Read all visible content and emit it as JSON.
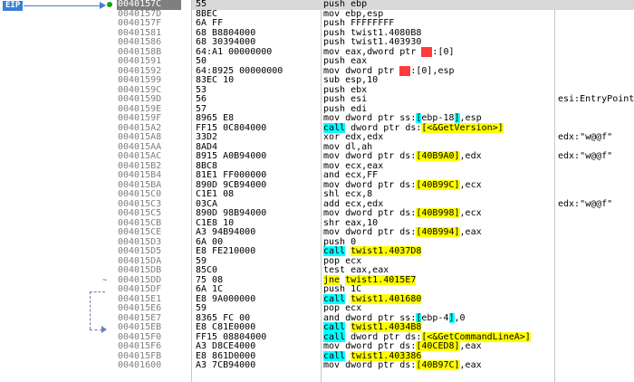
{
  "eip_label": "EIP",
  "rows": [
    {
      "addr": "0040157C",
      "bytes": "55",
      "instr": [
        {
          "t": "push ebp"
        }
      ],
      "comment": "",
      "current": true,
      "bp": true
    },
    {
      "addr": "0040157D",
      "bytes": "8BEC",
      "instr": [
        {
          "t": "mov ebp,esp"
        }
      ],
      "comment": ""
    },
    {
      "addr": "0040157F",
      "bytes": "6A FF",
      "instr": [
        {
          "t": "push FFFFFFFF"
        }
      ],
      "comment": ""
    },
    {
      "addr": "00401581",
      "bytes": "68 B8804000",
      "instr": [
        {
          "t": "push twist1.4080B8"
        }
      ],
      "comment": ""
    },
    {
      "addr": "00401586",
      "bytes": "68 30394000",
      "instr": [
        {
          "t": "push twist1.403930"
        }
      ],
      "comment": ""
    },
    {
      "addr": "0040158B",
      "bytes": "64:A1 00000000",
      "instr": [
        {
          "t": "mov eax,dword ptr "
        },
        {
          "t": "fs",
          "h": "red"
        },
        {
          "t": ":[0]"
        }
      ],
      "comment": ""
    },
    {
      "addr": "00401591",
      "bytes": "50",
      "instr": [
        {
          "t": "push eax"
        }
      ],
      "comment": ""
    },
    {
      "addr": "00401592",
      "bytes": "64:8925 00000000",
      "instr": [
        {
          "t": "mov dword ptr "
        },
        {
          "t": "fs",
          "h": "red"
        },
        {
          "t": ":[0],esp"
        }
      ],
      "comment": ""
    },
    {
      "addr": "00401599",
      "bytes": "83EC 10",
      "instr": [
        {
          "t": "sub esp,10"
        }
      ],
      "comment": ""
    },
    {
      "addr": "0040159C",
      "bytes": "53",
      "instr": [
        {
          "t": "push ebx"
        }
      ],
      "comment": ""
    },
    {
      "addr": "0040159D",
      "bytes": "56",
      "instr": [
        {
          "t": "push esi"
        }
      ],
      "comment": "esi:EntryPoint"
    },
    {
      "addr": "0040159E",
      "bytes": "57",
      "instr": [
        {
          "t": "push edi"
        }
      ],
      "comment": ""
    },
    {
      "addr": "0040159F",
      "bytes": "8965 E8",
      "instr": [
        {
          "t": "mov dword ptr ss:"
        },
        {
          "t": "[",
          "h": "cyan"
        },
        {
          "t": "ebp-18"
        },
        {
          "t": "]",
          "h": "cyan"
        },
        {
          "t": ",esp"
        }
      ],
      "comment": ""
    },
    {
      "addr": "004015A2",
      "bytes": "FF15 0C804000",
      "instr": [
        {
          "t": "call",
          "h": "cyan"
        },
        {
          "t": " dword ptr ds:"
        },
        {
          "t": "[<&GetVersion>]",
          "h": "yellow"
        }
      ],
      "comment": ""
    },
    {
      "addr": "004015A8",
      "bytes": "33D2",
      "instr": [
        {
          "t": "xor edx,edx"
        }
      ],
      "comment": "edx:\"w@@f\""
    },
    {
      "addr": "004015AA",
      "bytes": "8AD4",
      "instr": [
        {
          "t": "mov dl,ah"
        }
      ],
      "comment": ""
    },
    {
      "addr": "004015AC",
      "bytes": "8915 A0B94000",
      "instr": [
        {
          "t": "mov dword ptr ds:"
        },
        {
          "t": "[40B9A0]",
          "h": "yellow"
        },
        {
          "t": ",edx"
        }
      ],
      "comment": "edx:\"w@@f\""
    },
    {
      "addr": "004015B2",
      "bytes": "8BC8",
      "instr": [
        {
          "t": "mov ecx,eax"
        }
      ],
      "comment": ""
    },
    {
      "addr": "004015B4",
      "bytes": "81E1 FF000000",
      "instr": [
        {
          "t": "and ecx,FF"
        }
      ],
      "comment": ""
    },
    {
      "addr": "004015BA",
      "bytes": "890D 9CB94000",
      "instr": [
        {
          "t": "mov dword ptr ds:"
        },
        {
          "t": "[40B99C]",
          "h": "yellow"
        },
        {
          "t": ",ecx"
        }
      ],
      "comment": ""
    },
    {
      "addr": "004015C0",
      "bytes": "C1E1 08",
      "instr": [
        {
          "t": "shl ecx,8"
        }
      ],
      "comment": ""
    },
    {
      "addr": "004015C3",
      "bytes": "03CA",
      "instr": [
        {
          "t": "add ecx,edx"
        }
      ],
      "comment": "edx:\"w@@f\""
    },
    {
      "addr": "004015C5",
      "bytes": "890D 98B94000",
      "instr": [
        {
          "t": "mov dword ptr ds:"
        },
        {
          "t": "[40B998]",
          "h": "yellow"
        },
        {
          "t": ",ecx"
        }
      ],
      "comment": ""
    },
    {
      "addr": "004015CB",
      "bytes": "C1E8 10",
      "instr": [
        {
          "t": "shr eax,10"
        }
      ],
      "comment": ""
    },
    {
      "addr": "004015CE",
      "bytes": "A3 94B94000",
      "instr": [
        {
          "t": "mov dword ptr ds:"
        },
        {
          "t": "[40B994]",
          "h": "yellow"
        },
        {
          "t": ",eax"
        }
      ],
      "comment": ""
    },
    {
      "addr": "004015D3",
      "bytes": "6A 00",
      "instr": [
        {
          "t": "push 0"
        }
      ],
      "comment": ""
    },
    {
      "addr": "004015D5",
      "bytes": "E8 FE210000",
      "instr": [
        {
          "t": "call",
          "h": "cyan"
        },
        {
          "t": " "
        },
        {
          "t": "twist1.4037D8",
          "h": "yellow"
        }
      ],
      "comment": ""
    },
    {
      "addr": "004015DA",
      "bytes": "59",
      "instr": [
        {
          "t": "pop ecx"
        }
      ],
      "comment": ""
    },
    {
      "addr": "004015DB",
      "bytes": "85C0",
      "instr": [
        {
          "t": "test eax,eax"
        }
      ],
      "comment": ""
    },
    {
      "addr": "004015DD",
      "bytes": "75 08",
      "instr": [
        {
          "t": "jne",
          "h": "yellow"
        },
        {
          "t": " "
        },
        {
          "t": "twist1.4015E7",
          "h": "yellow"
        }
      ],
      "comment": "",
      "jmark": "~"
    },
    {
      "addr": "004015DF",
      "bytes": "6A 1C",
      "instr": [
        {
          "t": "push 1C"
        }
      ],
      "comment": ""
    },
    {
      "addr": "004015E1",
      "bytes": "E8 9A000000",
      "instr": [
        {
          "t": "call",
          "h": "cyan"
        },
        {
          "t": " "
        },
        {
          "t": "twist1.401680",
          "h": "yellow"
        }
      ],
      "comment": ""
    },
    {
      "addr": "004015E6",
      "bytes": "59",
      "instr": [
        {
          "t": "pop ecx"
        }
      ],
      "comment": ""
    },
    {
      "addr": "004015E7",
      "bytes": "8365 FC 00",
      "instr": [
        {
          "t": "and dword ptr ss:"
        },
        {
          "t": "[",
          "h": "cyan"
        },
        {
          "t": "ebp-4"
        },
        {
          "t": "]",
          "h": "cyan"
        },
        {
          "t": ",0"
        }
      ],
      "comment": ""
    },
    {
      "addr": "004015EB",
      "bytes": "E8 C81E0000",
      "instr": [
        {
          "t": "call",
          "h": "cyan"
        },
        {
          "t": " "
        },
        {
          "t": "twist1.4034B8",
          "h": "yellow"
        }
      ],
      "comment": ""
    },
    {
      "addr": "004015F0",
      "bytes": "FF15 08804000",
      "instr": [
        {
          "t": "call",
          "h": "cyan"
        },
        {
          "t": " dword ptr ds:"
        },
        {
          "t": "[<&GetCommandLineA>]",
          "h": "yellow"
        }
      ],
      "comment": ""
    },
    {
      "addr": "004015F6",
      "bytes": "A3 D8CE4000",
      "instr": [
        {
          "t": "mov dword ptr ds:"
        },
        {
          "t": "[40CED8]",
          "h": "yellow"
        },
        {
          "t": ",eax"
        }
      ],
      "comment": ""
    },
    {
      "addr": "004015FB",
      "bytes": "E8 861D0000",
      "instr": [
        {
          "t": "call",
          "h": "cyan"
        },
        {
          "t": " "
        },
        {
          "t": "twist1.403386",
          "h": "yellow"
        }
      ],
      "comment": ""
    },
    {
      "addr": "00401600",
      "bytes": "A3 7CB94000",
      "instr": [
        {
          "t": "mov dword ptr ds:"
        },
        {
          "t": "[40B97C]",
          "h": "yellow"
        },
        {
          "t": ",eax"
        }
      ],
      "comment": ""
    }
  ]
}
